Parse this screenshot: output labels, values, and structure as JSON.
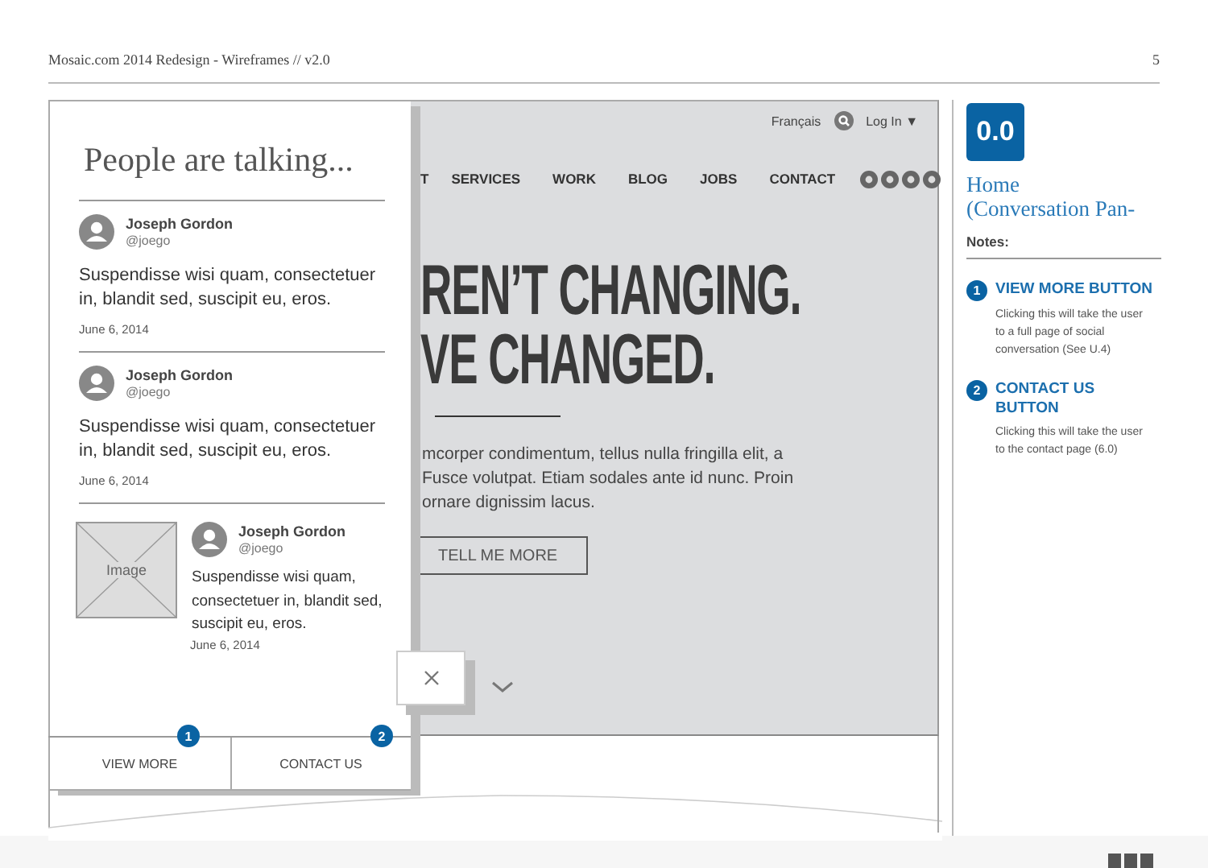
{
  "document": {
    "title": "Mosaic.com 2014 Redesign - Wireframes // v2.0",
    "page_number": "5"
  },
  "site": {
    "utility": {
      "language": "Français",
      "login": "Log In ▼"
    },
    "nav": [
      "T",
      "SERVICES",
      "WORK",
      "BLOG",
      "JOBS",
      "CONTACT"
    ],
    "hero_lines": [
      "REN’T CHANGING.",
      "VE CHANGED."
    ],
    "hero_text_lines": [
      "mcorper condimentum, tellus nulla fringilla elit, a",
      "Fusce volutpat. Etiam sodales ante id nunc. Proin",
      "ornare dignissim lacus."
    ],
    "cta": "TELL ME MORE"
  },
  "panel": {
    "title": "People are talking...",
    "posts": [
      {
        "kind": "text",
        "name": "Joseph Gordon",
        "handle": "@joego",
        "text": "Suspendisse wisi quam, consectetuer in, blandit sed, suscipit eu, eros.",
        "date": "June 6, 2014"
      },
      {
        "kind": "text",
        "name": "Joseph Gordon",
        "handle": "@joego",
        "text": "Suspendisse wisi quam, consectetuer in, blandit sed, suscipit eu, eros.",
        "date": "June 6, 2014"
      },
      {
        "kind": "image",
        "image_label": "Image",
        "name": "Joseph Gordon",
        "handle": "@joego",
        "text": "Suspendisse wisi quam, consectetuer in, blandit sed, suscipit eu, eros.",
        "date": "June 6, 2014"
      }
    ],
    "buttons": [
      {
        "label": "VIEW MORE",
        "marker": "1"
      },
      {
        "label": "CONTACT US",
        "marker": "2"
      }
    ]
  },
  "notes": {
    "screen_number": "0.0",
    "screen_title": "Home (Conversation Pan-",
    "heading": "Notes:",
    "items": [
      {
        "number": "1",
        "title": "VIEW MORE BUTTON",
        "text": "Clicking this will take the user to a full page of social conversation (See U.4)"
      },
      {
        "number": "2",
        "title": "CONTACT US BUTTON",
        "text": "Clicking this will take the user to the contact page (6.0)"
      }
    ]
  }
}
